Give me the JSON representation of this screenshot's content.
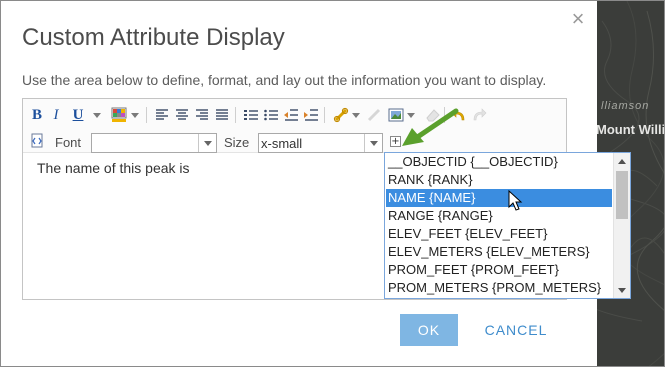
{
  "dialog": {
    "title": "Custom Attribute Display",
    "close_label": "×",
    "instructions": "Use the area below to define, format, and lay out the information you want to display."
  },
  "toolbar": {
    "bold_label": "B",
    "italic_label": "I",
    "underline_label": "U",
    "font_label": "Font",
    "font_value": "",
    "size_label": "Size",
    "size_value": "x-small",
    "insert_field_label": "+"
  },
  "editor": {
    "content_text": "The name of this peak is"
  },
  "field_list": {
    "items": [
      "__OBJECTID {__OBJECTID}",
      "RANK {RANK}",
      "NAME {NAME}",
      "RANGE {RANGE}",
      "ELEV_FEET {ELEV_FEET}",
      "ELEV_METERS {ELEV_METERS}",
      "PROM_FEET {PROM_FEET}",
      "PROM_METERS {PROM_METERS}"
    ],
    "selected_index": 2
  },
  "buttons": {
    "ok_label": "OK",
    "cancel_label": "CANCEL"
  },
  "map": {
    "label_1": "lliamson",
    "label_2": "Mount Willi"
  },
  "colors": {
    "accent": "#3b8de0",
    "ok_button": "#7fb6e3",
    "annotation_arrow": "#5aa02c"
  }
}
